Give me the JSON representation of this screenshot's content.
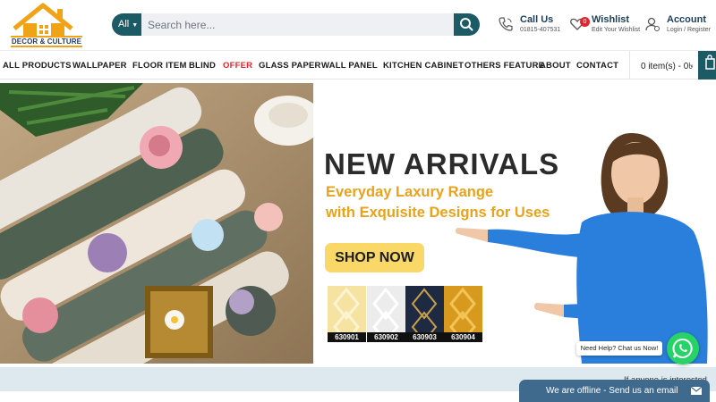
{
  "logo": {
    "text": "DECOR & CULTURE"
  },
  "search": {
    "category": "All",
    "placeholder": "Search here..."
  },
  "header": {
    "call": {
      "title": "Call Us",
      "sub": "01815-407531"
    },
    "wishlist": {
      "title": "Wishlist",
      "sub": "Edit Your Wishlist",
      "count": "0"
    },
    "account": {
      "title": "Account",
      "sub": "Login / Register"
    }
  },
  "nav": {
    "items": [
      {
        "label": "ALL PRODUCTS"
      },
      {
        "label": "WALLPAPER"
      },
      {
        "label": "FLOOR ITEM"
      },
      {
        "label": "BLIND"
      },
      {
        "label": "OFFER"
      },
      {
        "label": "GLASS PAPER"
      },
      {
        "label": "WALL PANEL"
      },
      {
        "label": "KITCHEN CABINET"
      },
      {
        "label": "OTHERS FEATURE"
      },
      {
        "label": "ABOUT"
      },
      {
        "label": "CONTACT"
      }
    ],
    "cart": "0 item(s) - 0৳"
  },
  "banner": {
    "headline": "NEW ARRIVALS",
    "tagline1": "Everyday Laxury Range",
    "tagline2": "with Exquisite Designs for Uses",
    "cta": "SHOP NOW",
    "swatches": [
      {
        "code": "630901",
        "bg": "#f6e3a2",
        "fg": "#fbf3d2"
      },
      {
        "code": "630902",
        "bg": "#ececec",
        "fg": "#ffffff"
      },
      {
        "code": "630903",
        "bg": "#1d2a42",
        "fg": "#c8a04a"
      },
      {
        "code": "630904",
        "bg": "#d79a1f",
        "fg": "#f2c456"
      }
    ]
  },
  "strip": {
    "text": "If anyone is interested"
  },
  "help": {
    "text": "Need Help? Chat us Now!"
  },
  "chat": {
    "text": "We are offline - Send us an email"
  },
  "colors": {
    "primary": "#1c5a66",
    "accent": "#e9a21a",
    "offer": "#e3242b",
    "whatsapp": "#25d366"
  }
}
